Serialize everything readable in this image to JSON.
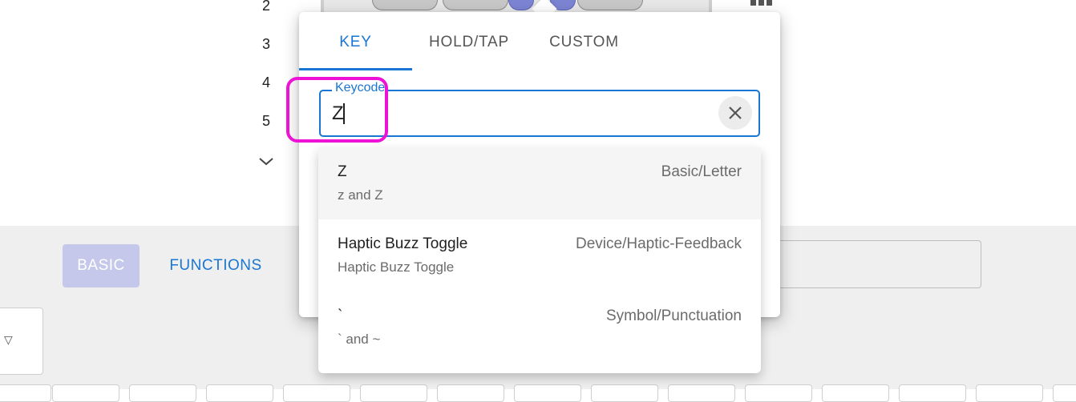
{
  "layers": {
    "numbers": [
      "2",
      "3",
      "4",
      "5"
    ],
    "expand_icon": "chevron-down-icon"
  },
  "popup": {
    "tabs": [
      {
        "label": "KEY",
        "active": true
      },
      {
        "label": "HOLD/TAP",
        "active": false
      },
      {
        "label": "CUSTOM",
        "active": false
      }
    ],
    "keycode": {
      "label": "Keycode",
      "value": "Z",
      "clear_icon": "close-icon"
    },
    "results": [
      {
        "title": "Z",
        "subtitle": "z and Z",
        "category": "Basic/Letter",
        "selected": true
      },
      {
        "title": "Haptic Buzz Toggle",
        "subtitle": "Haptic Buzz Toggle",
        "category": "Device/Haptic-Feedback",
        "selected": false
      },
      {
        "title": "`",
        "subtitle": "` and ~",
        "category": "Symbol/Punctuation",
        "selected": false
      }
    ]
  },
  "categories": {
    "basic": "BASIC",
    "functions": "FUNCTIONS"
  },
  "side_select": {
    "icon": "triangle-down-icon"
  },
  "colors": {
    "accent": "#1976d2",
    "highlight": "#ee12d6",
    "basic_active_bg": "#c5c8ea",
    "panel_bg": "#efefef"
  }
}
